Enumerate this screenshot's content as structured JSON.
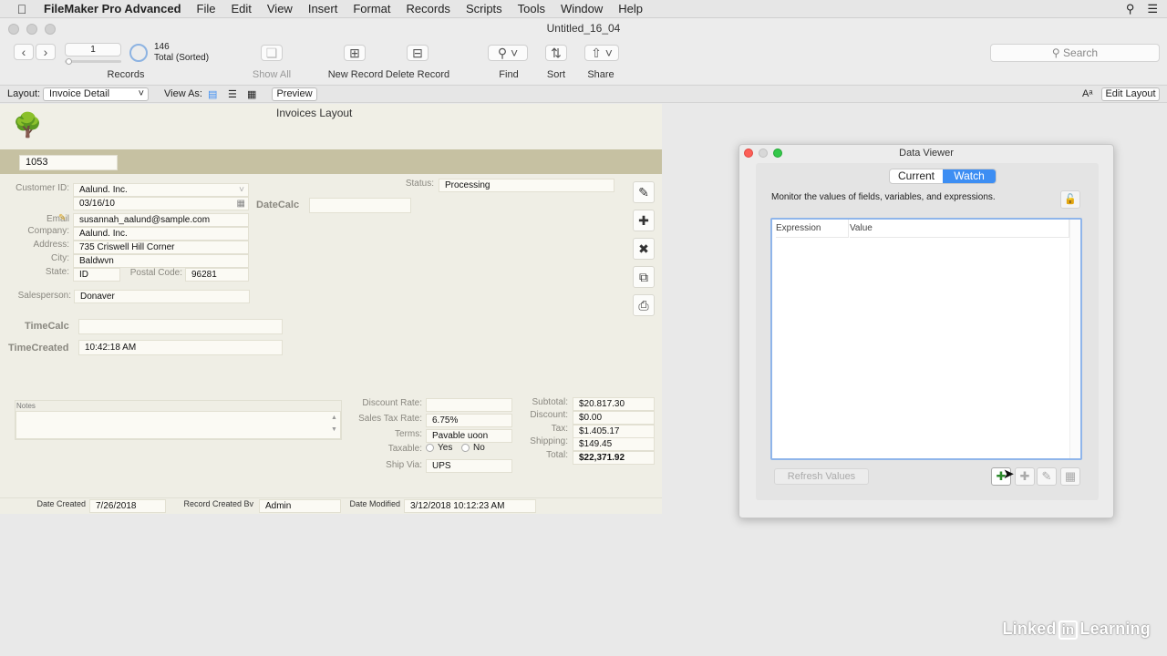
{
  "menubar": {
    "app_name": "FileMaker Pro Advanced",
    "menus": [
      "File",
      "Edit",
      "View",
      "Insert",
      "Format",
      "Records",
      "Scripts",
      "Tools",
      "Window",
      "Help"
    ]
  },
  "window": {
    "title": "Untitled_16_04"
  },
  "toolbar": {
    "record_number": "1",
    "found_count": "146",
    "found_status": "Total (Sorted)",
    "records_label": "Records",
    "show_all_label": "Show All",
    "new_record_label": "New Record",
    "delete_record_label": "Delete Record",
    "find_label": "Find",
    "sort_label": "Sort",
    "share_label": "Share",
    "search_placeholder": "Search"
  },
  "layout_bar": {
    "layout_label": "Layout:",
    "layout_value": "Invoice Detail",
    "view_as_label": "View As:",
    "preview_label": "Preview",
    "edit_layout_label": "Edit Layout"
  },
  "form": {
    "layout_title": "Invoices Layout",
    "invoice_id": "1053",
    "labels": {
      "customer_id": "Customer ID:",
      "email": "Email",
      "company": "Company:",
      "address": "Address:",
      "city": "City:",
      "state": "State:",
      "postal_code": "Postal Code:",
      "salesperson": "Salesperson:",
      "status": "Status:",
      "datecalc": "DateCalc",
      "timecalc": "TimeCalc",
      "timecreated": "TimeCreated",
      "notes": "Notes",
      "discount_rate": "Discount Rate:",
      "sales_tax_rate": "Sales Tax Rate:",
      "terms": "Terms:",
      "taxable": "Taxable:",
      "ship_via": "Ship Via:",
      "subtotal": "Subtotal:",
      "discount": "Discount:",
      "tax": "Tax:",
      "shipping": "Shipping:",
      "total": "Total:",
      "date_created": "Date Created",
      "record_created_by": "Record Created Bv",
      "date_modified": "Date Modified"
    },
    "values": {
      "customer_name": "Aalund. Inc.",
      "date": "03/16/10",
      "email": "susannah_aalund@sample.com",
      "company": "Aalund. Inc.",
      "address": "735 Criswell Hill Corner",
      "city": "Baldwvn",
      "state": "ID",
      "postal_code": "96281",
      "salesperson": "Donaver",
      "status": "Processing",
      "datecalc": "",
      "timecalc": "",
      "timecreated": "10:42:18 AM",
      "notes": "",
      "discount_rate": "",
      "sales_tax_rate": "6.75%",
      "terms": "Pavable uoon",
      "taxable_yes": "Yes",
      "taxable_no": "No",
      "ship_via": "UPS",
      "subtotal": "$20.817.30",
      "discount": "$0.00",
      "tax": "$1.405.17",
      "shipping": "$149.45",
      "total": "$22,371.92",
      "date_created": "7/26/2018",
      "record_created_by": "Admin",
      "date_modified": "3/12/2018 10:12:23 AM"
    }
  },
  "data_viewer": {
    "title": "Data Viewer",
    "tab_current": "Current",
    "tab_watch": "Watch",
    "description": "Monitor the values of fields, variables, and expressions.",
    "col_expression": "Expression",
    "col_value": "Value",
    "refresh_label": "Refresh Values"
  },
  "branding": {
    "linked": "Linked",
    "in": "in",
    "learning": "Learning"
  },
  "colors": {
    "accent": "#3d8ef3",
    "band": "#c6c1a2",
    "form_bg": "#efeee5"
  }
}
